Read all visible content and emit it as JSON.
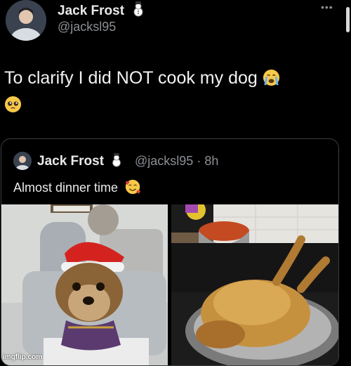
{
  "tweet": {
    "author_name": "Jack Frost",
    "author_handle": "@jacksl95",
    "more_icon": "more-icon",
    "text": "To clarify I did NOT cook my dog"
  },
  "quoted_tweet": {
    "author_name": "Jack Frost",
    "author_handle": "@jacksl95",
    "time": "8h",
    "text": "Almost dinner time"
  },
  "watermark": "imgflip.com",
  "colors": {
    "background": "#000000",
    "text": "#eaeaea",
    "secondary": "#8b8f94",
    "border": "#3a3d42"
  }
}
